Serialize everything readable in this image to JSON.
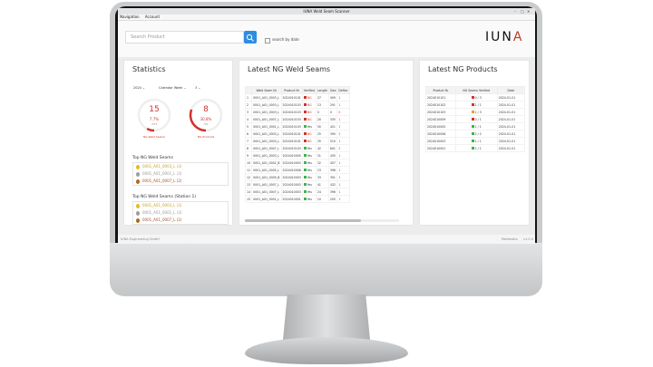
{
  "window": {
    "title": "IUNA Weld Seam Scanner",
    "controls": [
      "–",
      "▢",
      "✕"
    ]
  },
  "menu": {
    "items": [
      "Navigation",
      "Account"
    ]
  },
  "search": {
    "placeholder": "Search Product",
    "checkbox_label": "search by date"
  },
  "logo": {
    "text_main": "IUN",
    "text_accent": "A"
  },
  "statistics": {
    "title": "Statistics",
    "year": "2024",
    "period": "Calendar Week",
    "week": "3",
    "seams": {
      "count": "15",
      "percent": "7.7%",
      "of": "/193",
      "label": "NG Weld Seams"
    },
    "products": {
      "count": "8",
      "percent": "30.8%",
      "of": "/26",
      "label": "NG Products"
    },
    "top_seams_title": "Top NG Weld Seams",
    "top_seams": [
      "0001_A01_0003_L (3)",
      "0001_A01_0001_L (3)",
      "0001_A01_0007_L (2)"
    ],
    "top_station_title": "Top NG Weld Seams (Station 1)",
    "top_station": [
      "0001_A01_0003_L (3)",
      "0001_A01_0001_L (3)",
      "0001_A01_0007_L (2)"
    ],
    "colors": {
      "gold": "#e8b923",
      "silver": "#9e9e9e",
      "bronze": "#b5651d",
      "accent_red": "#d0322b"
    }
  },
  "weld_seams": {
    "title": "Latest NG Weld Seams",
    "columns": [
      "",
      "Weld Seam Nr",
      "Product Nr",
      "Verified",
      "Length",
      "Size",
      "Deflec"
    ],
    "rows": [
      [
        "1",
        "0001_A01_0003_L",
        "2024010101",
        "NG",
        "NG",
        "27",
        "409",
        "1"
      ],
      [
        "2",
        "0001_A01_0003_L",
        "2024010103",
        "NG",
        "NG",
        "13",
        "291",
        "1"
      ],
      [
        "3",
        "0001_A01_0003_L",
        "2024010103",
        "NG",
        "NG",
        "0",
        "0",
        "0"
      ],
      [
        "4",
        "0001_A01_0007_L",
        "2024010103",
        "NG",
        "NG",
        "20",
        "335",
        "1"
      ],
      [
        "5",
        "0001_A01_0001_L",
        "2024010103",
        "OK",
        "Yes",
        "50",
        "421",
        "1"
      ],
      [
        "6",
        "0001_A01_0003_L",
        "2024010101",
        "NG",
        "NG",
        "25",
        "395",
        "2"
      ],
      [
        "7",
        "0001_A01_0003_L",
        "2024010101",
        "NG",
        "NG",
        "35",
        "510",
        "1"
      ],
      [
        "8",
        "0001_A01_0007_L",
        "2024010103",
        "OK",
        "Yes",
        "42",
        "601",
        "2"
      ],
      [
        "9",
        "0001_A01_0003_L",
        "2024010005",
        "OK",
        "Yes",
        "31",
        "435",
        "1"
      ],
      [
        "10",
        "0001_A01_0001_B",
        "2024010003",
        "OK",
        "Yes",
        "32",
        "457",
        "1"
      ],
      [
        "11",
        "0001_A01_0005_L",
        "2024010006",
        "OK",
        "Yes",
        "23",
        "398",
        "1"
      ],
      [
        "12",
        "0001_A01_0009_B",
        "2024010003",
        "OK",
        "Yes",
        "33",
        "391",
        "1"
      ],
      [
        "13",
        "0001_A01_0007_L",
        "2024010003",
        "OK",
        "Yes",
        "41",
        "432",
        "1"
      ],
      [
        "14",
        "0001_A01_0007_L",
        "2024010003",
        "OK",
        "Yes",
        "24",
        "396",
        "1"
      ],
      [
        "15",
        "0001_A01_0001_L",
        "2024010001",
        "OK",
        "Yes",
        "10",
        "205",
        "1"
      ]
    ]
  },
  "products": {
    "title": "Latest NG Products",
    "columns": [
      "Product Nr",
      "NG Seams Verified",
      "Date"
    ],
    "rows": [
      [
        "2024010101",
        "NG",
        "0 / 3",
        "2024-01-01"
      ],
      [
        "2024010102",
        "NG",
        "1 / 1",
        "2024-01-01"
      ],
      [
        "2024010103",
        "WARN",
        "1 / 3",
        "2024-01-01"
      ],
      [
        "2024010009",
        "NG",
        "0 / 1",
        "2024-01-01"
      ],
      [
        "2024010005",
        "OK",
        "1 / 1",
        "2024-01-01"
      ],
      [
        "2024010006",
        "OK",
        "2 / 2",
        "2024-01-01"
      ],
      [
        "2024010003",
        "OK",
        "1 / 1",
        "2024-01-01"
      ],
      [
        "2024010001",
        "OK",
        "1 / 1",
        "2024-01-01"
      ]
    ]
  },
  "status": {
    "left": "IUNA Engineering GmbH",
    "right_a": "Mollekalla",
    "right_b": "v1.0.0"
  }
}
